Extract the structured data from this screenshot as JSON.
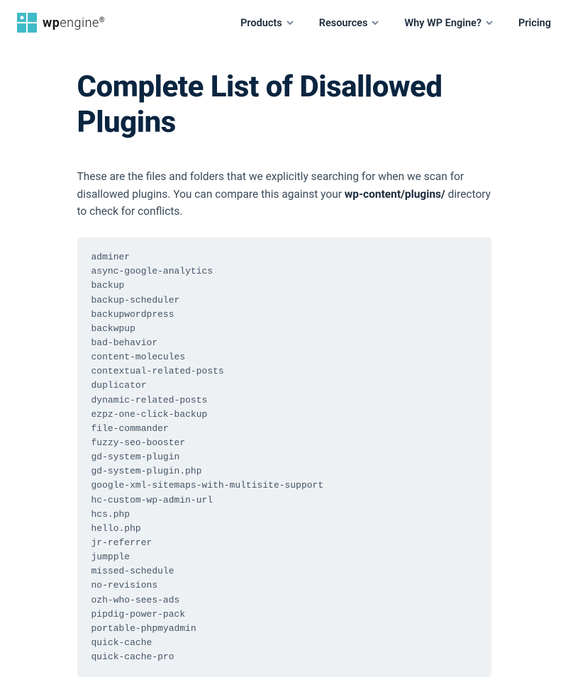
{
  "header": {
    "logo_bold": "wp",
    "logo_light": "engine",
    "logo_reg": "®",
    "nav": {
      "products": "Products",
      "resources": "Resources",
      "why": "Why WP Engine?",
      "pricing": "Pricing"
    }
  },
  "page": {
    "title": "Complete List of Disallowed Plugins",
    "intro_before": "These are the files and folders that we explicitly searching for when we scan for disallowed plugins. You can compare this against your ",
    "intro_code": "wp-content/plugins/",
    "intro_after": " directory to check for conflicts."
  },
  "plugins": [
    "adminer",
    "async-google-analytics",
    "backup",
    "backup-scheduler",
    "backupwordpress",
    "backwpup",
    "bad-behavior",
    "content-molecules",
    "contextual-related-posts",
    "duplicator",
    "dynamic-related-posts",
    "ezpz-one-click-backup",
    "file-commander",
    "fuzzy-seo-booster",
    "gd-system-plugin",
    "gd-system-plugin.php",
    "google-xml-sitemaps-with-multisite-support",
    "hc-custom-wp-admin-url",
    "hcs.php",
    "hello.php",
    "jr-referrer",
    "jumpple",
    "missed-schedule",
    "no-revisions",
    "ozh-who-sees-ads",
    "pipdig-power-pack",
    "portable-phpmyadmin",
    "quick-cache",
    "quick-cache-pro"
  ]
}
